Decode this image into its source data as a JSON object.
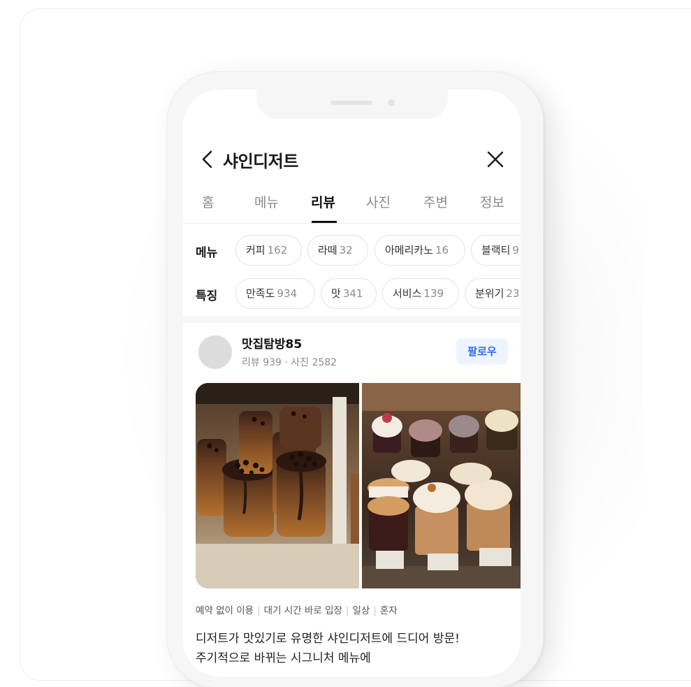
{
  "header": {
    "title": "샤인디저트",
    "back_icon": "chevron-left-icon",
    "close_icon": "close-icon"
  },
  "tabs": [
    {
      "label": "홈",
      "active": false
    },
    {
      "label": "메뉴",
      "active": false
    },
    {
      "label": "리뷰",
      "active": true
    },
    {
      "label": "사진",
      "active": false
    },
    {
      "label": "주변",
      "active": false
    },
    {
      "label": "정보",
      "active": false
    }
  ],
  "filters": {
    "menu": {
      "label": "메뉴",
      "chips": [
        {
          "name": "커피",
          "count": "162"
        },
        {
          "name": "라떼",
          "count": "32"
        },
        {
          "name": "아메리카노",
          "count": "16"
        },
        {
          "name": "블랙티",
          "count": "9"
        }
      ]
    },
    "features": {
      "label": "특징",
      "chips": [
        {
          "name": "만족도",
          "count": "934"
        },
        {
          "name": "맛",
          "count": "341"
        },
        {
          "name": "서비스",
          "count": "139"
        },
        {
          "name": "분위기",
          "count": "23"
        }
      ]
    }
  },
  "review": {
    "author": "맛집탐방85",
    "stats": "리뷰 939 · 사진 2582",
    "follow_label": "팔로우",
    "photos": [
      "chocolate-bread-photo",
      "cupcakes-photo"
    ],
    "tags": [
      "예약 없이 이용",
      "대기 시간 바로 입장",
      "일상",
      "혼자"
    ],
    "text_lines": [
      "디저트가 맛있기로 유명한 샤인디저트에 드디어 방문!",
      "주기적으로 바뀌는 시그니처 메뉴에"
    ]
  },
  "colors": {
    "accent": "#2f6df6",
    "follow_bg": "#eef4ff",
    "active_tab": "#111111",
    "inactive_tab": "#8a8a8a"
  }
}
